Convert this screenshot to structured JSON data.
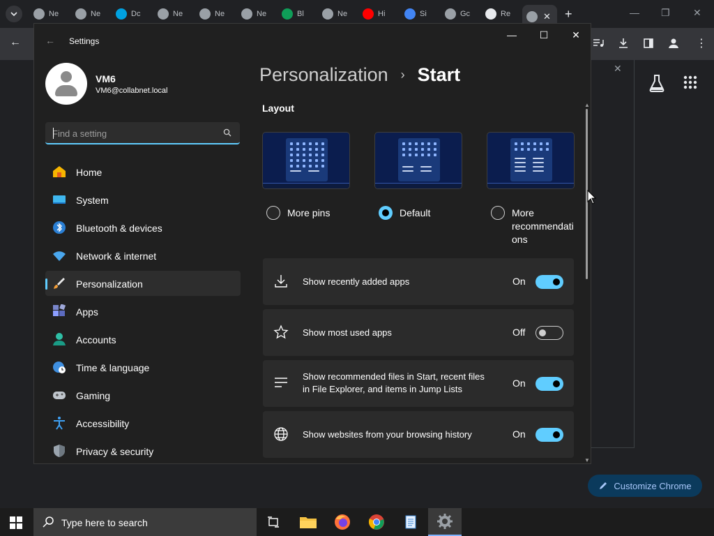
{
  "chrome": {
    "tabs": [
      {
        "label": "Ne",
        "icon": "chrome-icon"
      },
      {
        "label": "Ne",
        "icon": "chrome-icon"
      },
      {
        "label": "Dc",
        "icon": "salesforce-icon"
      },
      {
        "label": "Ne",
        "icon": "chrome-icon"
      },
      {
        "label": "Ne",
        "icon": "chrome-icon"
      },
      {
        "label": "Ne",
        "icon": "chrome-icon"
      },
      {
        "label": "Bl",
        "icon": "drive-icon"
      },
      {
        "label": "Ne",
        "icon": "chrome-icon"
      },
      {
        "label": "Hi",
        "icon": "youtube-icon"
      },
      {
        "label": "Si",
        "icon": "google-icon"
      },
      {
        "label": "Gc",
        "icon": "chrome-icon"
      },
      {
        "label": "Re",
        "icon": "github-icon"
      },
      {
        "label": "",
        "icon": "chrome-icon"
      }
    ],
    "new_tab": "+",
    "customize_label": "Customize Chrome"
  },
  "settings": {
    "title": "Settings",
    "user": {
      "name": "VM6",
      "email": "VM6@collabnet.local"
    },
    "search_placeholder": "Find a setting",
    "nav": [
      {
        "label": "Home",
        "icon": "home-icon"
      },
      {
        "label": "System",
        "icon": "system-icon"
      },
      {
        "label": "Bluetooth & devices",
        "icon": "bluetooth-icon"
      },
      {
        "label": "Network & internet",
        "icon": "wifi-icon"
      },
      {
        "label": "Personalization",
        "icon": "brush-icon"
      },
      {
        "label": "Apps",
        "icon": "apps-icon"
      },
      {
        "label": "Accounts",
        "icon": "accounts-icon"
      },
      {
        "label": "Time & language",
        "icon": "globe-clock-icon"
      },
      {
        "label": "Gaming",
        "icon": "gamepad-icon"
      },
      {
        "label": "Accessibility",
        "icon": "accessibility-icon"
      },
      {
        "label": "Privacy & security",
        "icon": "shield-icon"
      }
    ],
    "selected_nav": "Personalization",
    "breadcrumb": {
      "parent": "Personalization",
      "separator": "›",
      "current": "Start"
    },
    "layout": {
      "title": "Layout",
      "options": [
        {
          "label": "More pins",
          "selected": false
        },
        {
          "label": "Default",
          "selected": true
        },
        {
          "label": "More recommendations",
          "label_lines": [
            "More",
            "recommendati",
            "ons"
          ],
          "selected": false
        }
      ]
    },
    "toggles": [
      {
        "label": "Show recently added apps",
        "state": "On",
        "on": true,
        "icon": "download-icon"
      },
      {
        "label": "Show most used apps",
        "state": "Off",
        "on": false,
        "icon": "star-icon"
      },
      {
        "label_lines": [
          "Show recommended files in Start, recent files",
          "in File Explorer, and items in Jump Lists"
        ],
        "state": "On",
        "on": true,
        "icon": "list-icon"
      },
      {
        "label": "Show websites from your browsing history",
        "state": "On",
        "on": true,
        "icon": "globe-icon"
      }
    ]
  },
  "taskbar": {
    "search_placeholder": "Type here to search",
    "apps": [
      "task-view-icon",
      "file-explorer-icon",
      "firefox-icon",
      "chrome-icon",
      "notepad-icon",
      "settings-icon"
    ]
  }
}
